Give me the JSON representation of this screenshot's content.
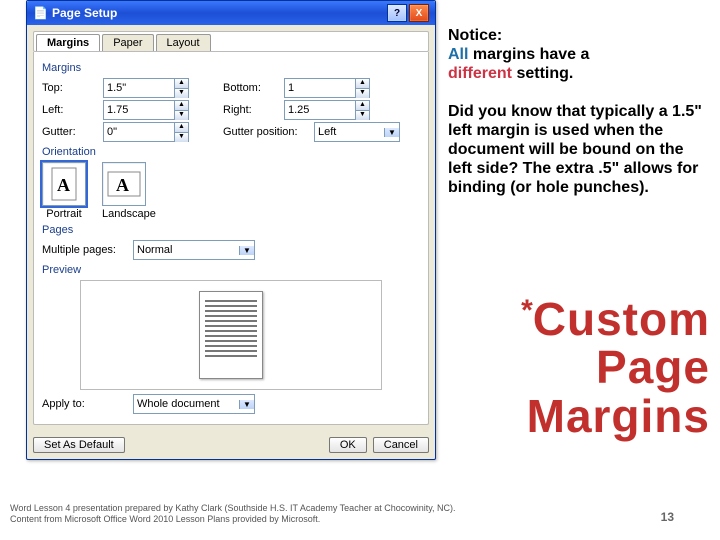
{
  "dialog": {
    "title": "Page Setup",
    "tabs": [
      "Margins",
      "Paper",
      "Layout"
    ],
    "section_margins": "Margins",
    "fields": {
      "top_lbl": "Top:",
      "top": "1.5\"",
      "bottom_lbl": "Bottom:",
      "bottom": "1",
      "left_lbl": "Left:",
      "left": "1.75",
      "right_lbl": "Right:",
      "right": "1.25",
      "gutter_lbl": "Gutter:",
      "gutter": "0\"",
      "gutterpos_lbl": "Gutter position:",
      "gutterpos": "Left"
    },
    "section_orient": "Orientation",
    "orient_portrait": "Portrait",
    "orient_landscape": "Landscape",
    "section_pages": "Pages",
    "multiple_lbl": "Multiple pages:",
    "multiple": "Normal",
    "section_preview": "Preview",
    "apply_lbl": "Apply to:",
    "apply": "Whole document",
    "set_default": "Set As Default",
    "ok": "OK",
    "cancel": "Cancel",
    "help": "?",
    "close": "X"
  },
  "notice": {
    "head": "Notice:",
    "line1a": "All ",
    "line1b": "margins have a",
    "line2a": "different ",
    "line2b": "setting."
  },
  "tip": "Did you know that typically a 1.5\" left margin is used when the document will be bound on the left side? The extra .5\" allows for binding (or hole punches).",
  "title": {
    "w1": "Custom",
    "w2": "Page",
    "w3": "Margins"
  },
  "footer": "Word Lesson 4 presentation prepared by Kathy Clark (Southside H.S. IT Academy Teacher at Chocowinity, NC). Content from Microsoft Office Word 2010 Lesson Plans provided by Microsoft.",
  "pagenum": "13"
}
